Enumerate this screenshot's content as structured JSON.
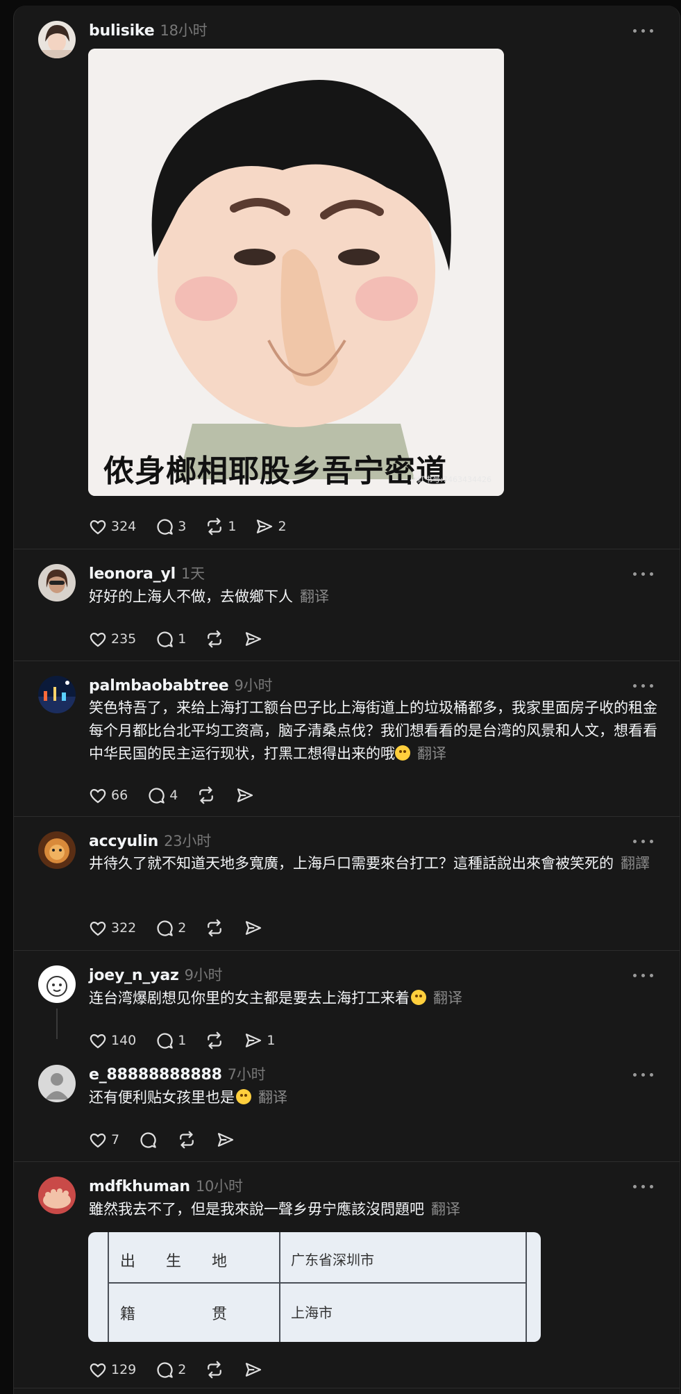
{
  "posts": [
    {
      "username": "bulisike",
      "time": "18小时",
      "image_caption": "侬身榔相耶股乡吾宁密道",
      "watermark": "小红书号:7463434426",
      "likes": "324",
      "replies": "3",
      "reposts": "1",
      "shares": "2"
    },
    {
      "username": "leonora_yl",
      "time": "1天",
      "text": "好好的上海人不做，去做鄉下人",
      "translate": "翻译",
      "likes": "235",
      "replies": "1"
    },
    {
      "username": "palmbaobabtree",
      "time": "9小时",
      "text": "笑色特吾了，来给上海打工额台巴子比上海街道上的垃圾桶都多，我家里面房子收的租金每个月都比台北平均工资高，脑子清桑点伐？我们想看看的是台湾的风景和人文，想看看中华民国的民主运行现状，打黑工想得出来的哦",
      "translate": "翻译",
      "likes": "66",
      "replies": "4"
    },
    {
      "username": "accyulin",
      "time": "23小时",
      "text": "井待久了就不知道天地多寬廣，上海戶口需要來台打工？這種話說出來會被笑死的",
      "translate": "翻譯",
      "likes": "322",
      "replies": "2"
    },
    {
      "username": "joey_n_yaz",
      "time": "9小时",
      "text": "连台湾爆剧想见你里的女主都是要去上海打工来着",
      "translate": "翻译",
      "likes": "140",
      "replies": "1",
      "shares": "1"
    },
    {
      "username": "e_88888888888",
      "time": "7小时",
      "text": "还有便利贴女孩里也是",
      "translate": "翻译",
      "likes": "7"
    },
    {
      "username": "mdfkhuman",
      "time": "10小时",
      "text": "雖然我去不了，但是我來說一聲乡毋宁應該沒問題吧",
      "translate": "翻译",
      "likes": "129",
      "replies": "2",
      "table": {
        "row1_label": "出　　生　　地",
        "row1_value": "广东省深圳市",
        "row2_label": "籍　　　　　贯",
        "row2_value": "上海市"
      }
    }
  ],
  "colors": {
    "bg": "#181818",
    "text": "#f3f5f7",
    "muted": "#777777"
  }
}
